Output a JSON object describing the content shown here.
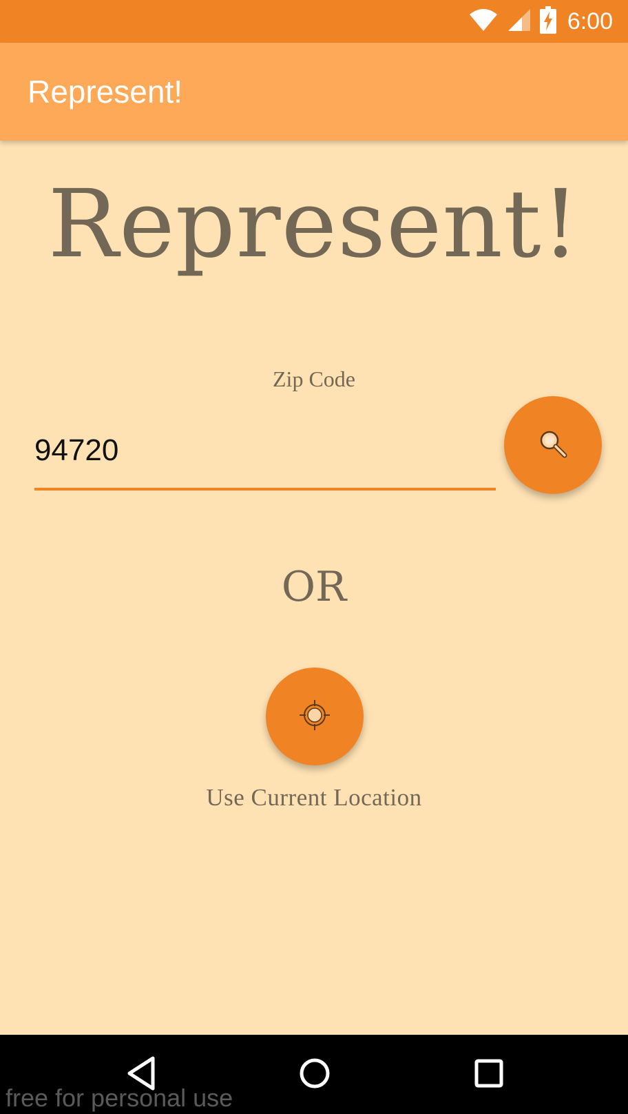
{
  "status_bar": {
    "time": "6:00",
    "icons": [
      "wifi-icon",
      "cellular-signal-icon",
      "battery-charging-icon"
    ]
  },
  "app_bar": {
    "title": "Represent!"
  },
  "main": {
    "hero_title": "Represent!",
    "zip_label": "Zip Code",
    "zip_value": "94720",
    "search_button_icon": "search-icon",
    "or_text": "OR",
    "location_button_icon": "location-crosshair-icon",
    "location_label": "Use Current Location"
  },
  "nav_bar": {
    "icons": [
      "back-icon",
      "home-icon",
      "recents-icon"
    ]
  },
  "watermark": "free for personal use",
  "colors": {
    "status_bar": "#F08424",
    "app_bar": "#FEA957",
    "background": "#FEE2B4",
    "accent": "#F08424",
    "text_muted": "#736856"
  }
}
